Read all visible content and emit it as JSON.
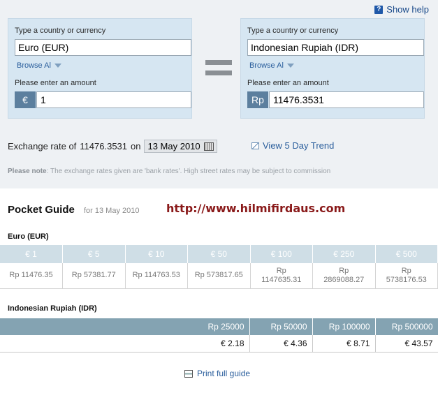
{
  "help": {
    "label": "Show help"
  },
  "from": {
    "type_label": "Type a country or currency",
    "currency": "Euro (EUR)",
    "browse_label": "Browse Al",
    "amount_label": "Please enter an amount",
    "symbol": "€",
    "amount": "1"
  },
  "to": {
    "type_label": "Type a country or currency",
    "currency": "Indonesian Rupiah (IDR)",
    "browse_label": "Browse Al",
    "amount_label": "Please enter an amount",
    "symbol": "Rp",
    "amount": "11476.3531"
  },
  "rate": {
    "prefix": "Exchange rate of",
    "value": "11476.3531",
    "on": "on",
    "date": "13 May 2010"
  },
  "trend": {
    "label": "View 5 Day Trend"
  },
  "note": {
    "bold": "Please note",
    "text": ": The exchange rates given are 'bank rates'. High street rates may be subject to commission"
  },
  "pocket": {
    "title": "Pocket Guide",
    "date": "for 13 May 2010",
    "url": "http://www.hilmifirdaus.com"
  },
  "euro_table": {
    "label": "Euro (EUR)",
    "headers": [
      "€ 1",
      "€ 5",
      "€ 10",
      "€ 50",
      "€ 100",
      "€ 250",
      "€ 500"
    ],
    "values": [
      "Rp 11476.35",
      "Rp 57381.77",
      "Rp 114763.53",
      "Rp 573817.65",
      "Rp\n1147635.31",
      "Rp\n2869088.27",
      "Rp\n5738176.53"
    ]
  },
  "idr_table": {
    "label": "Indonesian Rupiah (IDR)",
    "headers": [
      "Rp 25000",
      "Rp 50000",
      "Rp 100000",
      "Rp 500000"
    ],
    "values": [
      "€ 2.18",
      "€ 4.36",
      "€ 8.71",
      "€ 43.57"
    ]
  },
  "print": {
    "label": "Print full guide"
  },
  "colors": {
    "panel": "#d6e6f2",
    "link": "#2a5e9c",
    "header_dark": "#84a3b2",
    "url": "#8a1a1a"
  }
}
